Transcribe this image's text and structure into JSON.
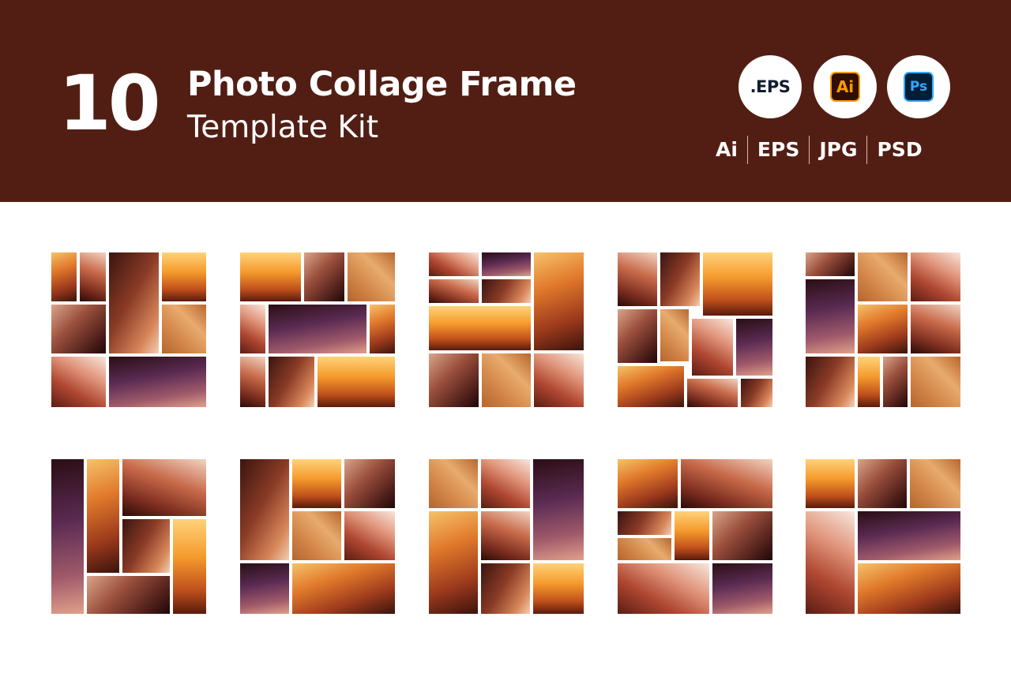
{
  "header": {
    "count": "10",
    "title": "Photo Collage Frame",
    "subtitle": "Template Kit",
    "badges": {
      "eps": ".EPS",
      "ai": "Ai",
      "ps": "Ps"
    },
    "formats": [
      "Ai",
      "EPS",
      "JPG",
      "PSD"
    ]
  },
  "colors": {
    "banner": "#521e14",
    "background": "#ffffff",
    "ai_orange": "#ff9a00",
    "ps_blue": "#31a8ff"
  },
  "previews": {
    "count": 10
  }
}
